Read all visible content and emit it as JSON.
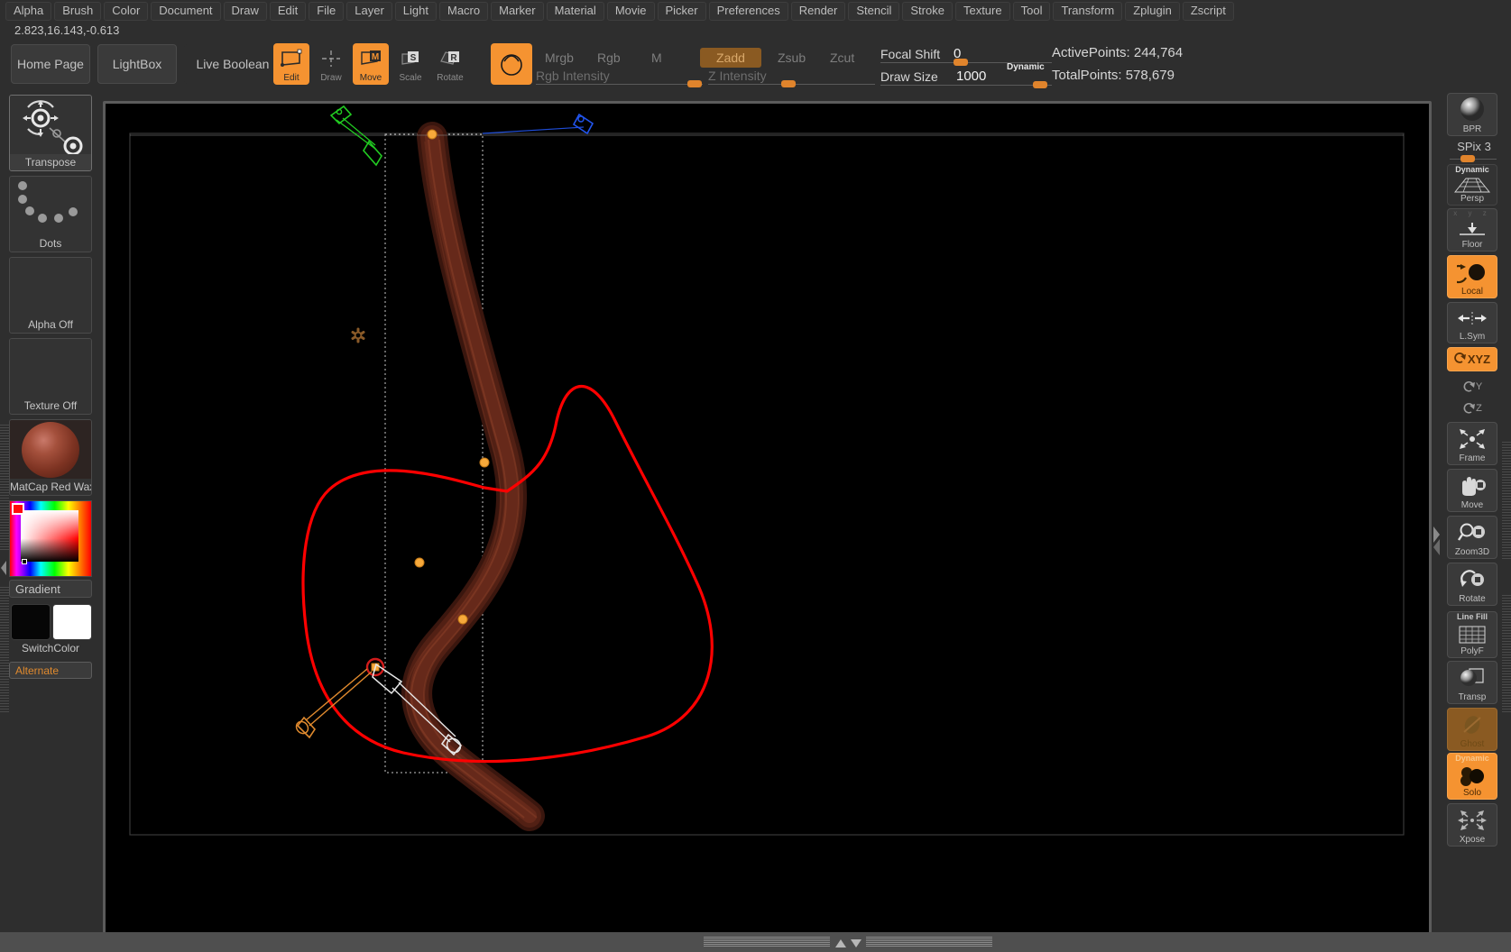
{
  "menubar": {
    "items": [
      {
        "label": "Alpha"
      },
      {
        "label": "Brush"
      },
      {
        "label": "Color"
      },
      {
        "label": "Document"
      },
      {
        "label": "Draw"
      },
      {
        "label": "Edit"
      },
      {
        "label": "File"
      },
      {
        "label": "Layer"
      },
      {
        "label": "Light"
      },
      {
        "label": "Macro"
      },
      {
        "label": "Marker"
      },
      {
        "label": "Material"
      },
      {
        "label": "Movie"
      },
      {
        "label": "Picker"
      },
      {
        "label": "Preferences"
      },
      {
        "label": "Render"
      },
      {
        "label": "Stencil"
      },
      {
        "label": "Stroke"
      },
      {
        "label": "Texture"
      },
      {
        "label": "Tool"
      },
      {
        "label": "Transform"
      },
      {
        "label": "Zplugin"
      },
      {
        "label": "Zscript"
      }
    ]
  },
  "status": {
    "coordinates": "2.823,16.143,-0.613"
  },
  "toolbar": {
    "home_page": "Home Page",
    "lightbox": "LightBox",
    "live_boolean": "Live Boolean",
    "modes": [
      {
        "name": "edit",
        "label": "Edit",
        "active": true
      },
      {
        "name": "draw",
        "label": "Draw",
        "active": false
      },
      {
        "name": "move",
        "label": "Move",
        "active": true
      },
      {
        "name": "scale",
        "label": "Scale",
        "active": false
      },
      {
        "name": "rotate",
        "label": "Rotate",
        "active": false
      }
    ],
    "brush_swatch": "brush-preview",
    "color_modes": [
      {
        "label": "Mrgb",
        "active": false
      },
      {
        "label": "Rgb",
        "active": false
      },
      {
        "label": "M",
        "active": false
      }
    ],
    "z_modes": [
      {
        "label": "Zadd",
        "active": true
      },
      {
        "label": "Zsub",
        "active": false
      },
      {
        "label": "Zcut",
        "active": false
      }
    ],
    "rgb_intensity_label": "Rgb Intensity",
    "z_intensity_label": "Z Intensity",
    "focal_shift_label": "Focal Shift",
    "focal_shift_value": "0",
    "draw_size_label": "Draw Size",
    "draw_size_value": "1000",
    "dynamic_label": "Dynamic",
    "active_points": "ActivePoints: 244,764",
    "total_points": "TotalPoints: 578,679"
  },
  "left_shelf": {
    "tiles": [
      {
        "name": "transpose",
        "label": "Transpose",
        "selected": true
      },
      {
        "name": "stroke-dots",
        "label": "Dots",
        "selected": false
      },
      {
        "name": "alpha",
        "label": "Alpha Off",
        "selected": false
      },
      {
        "name": "texture",
        "label": "Texture Off",
        "selected": false
      },
      {
        "name": "material",
        "label": "MatCap Red Wax",
        "selected": false
      }
    ],
    "gradient_label": "Gradient",
    "switch_color_label": "SwitchColor",
    "alternate_label": "Alternate",
    "primary_color": "#000000",
    "secondary_color": "#ffffff",
    "accent_color": "#e08a2e"
  },
  "right_shelf": {
    "items": [
      {
        "name": "bpr",
        "label": "BPR",
        "state": "normal"
      },
      {
        "name": "spix",
        "label": "SPix",
        "value": "3",
        "state": "slider"
      },
      {
        "name": "persp",
        "label": "Persp",
        "sublabel": "Dynamic",
        "state": "normal"
      },
      {
        "name": "floor",
        "label": "Floor",
        "state": "normal"
      },
      {
        "name": "local",
        "label": "Local",
        "state": "on"
      },
      {
        "name": "lsym",
        "label": "L.Sym",
        "state": "normal"
      },
      {
        "name": "xyz",
        "label": "XYZ",
        "state": "on"
      },
      {
        "name": "yaxis",
        "label": "Y",
        "state": "plain"
      },
      {
        "name": "zaxis",
        "label": "Z",
        "state": "plain"
      },
      {
        "name": "frame",
        "label": "Frame",
        "state": "normal"
      },
      {
        "name": "move",
        "label": "Move",
        "state": "normal"
      },
      {
        "name": "zoom3d",
        "label": "Zoom3D",
        "state": "normal"
      },
      {
        "name": "rotate",
        "label": "Rotate",
        "state": "normal"
      },
      {
        "name": "polyf",
        "label": "PolyF",
        "sublabel": "Line Fill",
        "state": "normal"
      },
      {
        "name": "transp",
        "label": "Transp",
        "state": "normal"
      },
      {
        "name": "ghost",
        "label": "Ghost",
        "state": "dim"
      },
      {
        "name": "solo",
        "label": "Solo",
        "sublabel": "Dynamic",
        "state": "on"
      },
      {
        "name": "xpose",
        "label": "Xpose",
        "state": "normal"
      }
    ]
  },
  "canvas": {
    "mesh_color": "#5a2418",
    "curve_color": "#ff0000",
    "handle_color": "#f5a030",
    "gizmo_green": "#22cc22",
    "gizmo_blue": "#2255ee",
    "gizmo_white": "#e8e8e8",
    "selection_box": "dotted-rect"
  }
}
